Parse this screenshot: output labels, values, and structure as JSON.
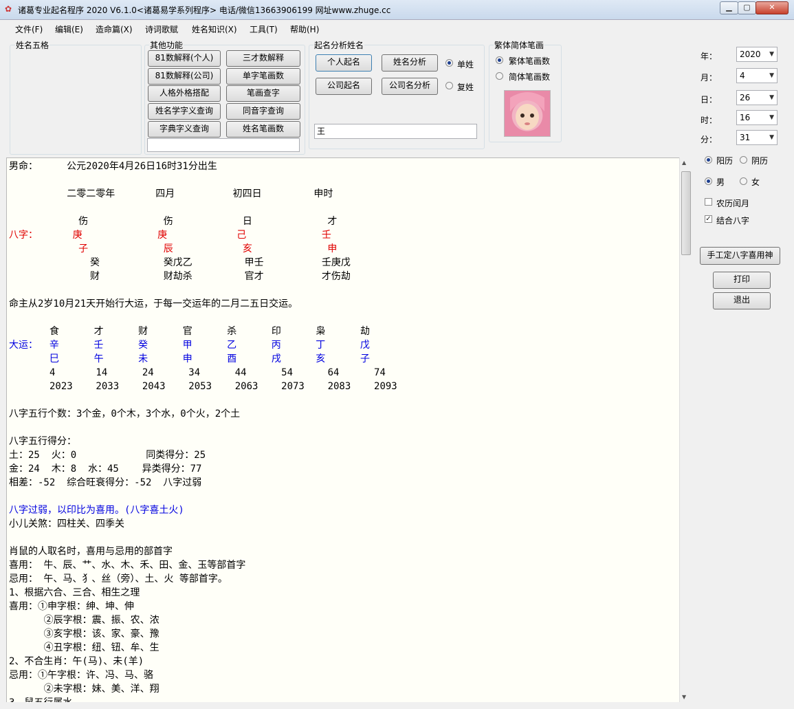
{
  "window": {
    "title": "诸葛专业起名程序  2020 V6.1.0<诸葛易学系列程序>  电话/微信13663906199  网址www.zhuge.cc",
    "icon": "app-flower-icon",
    "minimize_icon": "minimize-icon",
    "maximize_icon": "maximize-icon",
    "close_icon": "close-icon"
  },
  "menu": [
    "文件(F)",
    "编辑(E)",
    "造命篇(X)",
    "诗词歌赋",
    "姓名知识(X)",
    "工具(T)",
    "帮助(H)"
  ],
  "groups": {
    "wuge": "姓名五格",
    "other": "其他功能",
    "analysis": "起名分析姓名",
    "stroke": "繁体简体笔画"
  },
  "other_buttons": [
    "81数解释(个人)",
    "三才数解释",
    "81数解释(公司)",
    "单字笔画数",
    "人格外格搭配",
    "笔画查字",
    "姓名学字义查询",
    "同音字查询",
    "字典字义查询",
    "姓名笔画数"
  ],
  "analysis": {
    "personal_name": "个人起名",
    "name_analysis": "姓名分析",
    "company_name": "公司起名",
    "company_analysis": "公司名分析",
    "single_surname": "单姓",
    "double_surname": "复姓",
    "surname_value": "王"
  },
  "stroke": {
    "traditional": "繁体笔画数",
    "simplified": "简体笔画数",
    "photo": "baby-photo"
  },
  "datetime": {
    "year_label": "年：",
    "year": "2020",
    "month_label": "月：",
    "month": "4",
    "day_label": "日：",
    "day": "26",
    "hour_label": "时：",
    "hour": "16",
    "minute_label": "分：",
    "minute": "31"
  },
  "options": {
    "solar": "阳历",
    "lunar": "阴历",
    "male": "男",
    "female": "女",
    "leap_month": "农历闰月",
    "combine_bazi": "结合八字",
    "manual_button": "手工定八字喜用神",
    "print_button": "打印",
    "exit_button": "退出"
  },
  "colors": {
    "red_text": "#e00000",
    "blue_text": "#0000e0"
  },
  "content": {
    "lines": [
      {
        "t": "男命：     公元2020年4月26日16时31分出生",
        "c": ""
      },
      {
        "t": "",
        "c": ""
      },
      {
        "t": "          二零二零年       四月          初四日         申时",
        "c": ""
      },
      {
        "t": "",
        "c": ""
      },
      {
        "t": "            伤             伤            日             才",
        "c": ""
      },
      {
        "t": "八字：      庚             庚            己             壬",
        "c": "red"
      },
      {
        "t": "            子             辰            亥             申",
        "c": "red"
      },
      {
        "t": "              癸           癸戊乙         甲壬          壬庚戊",
        "c": ""
      },
      {
        "t": "              财           财劫杀         官才          才伤劫",
        "c": ""
      },
      {
        "t": "",
        "c": ""
      },
      {
        "t": "命主从2岁10月21天开始行大运，于每一交运年的二月二五日交运。",
        "c": ""
      },
      {
        "t": "",
        "c": ""
      },
      {
        "t": "       食      才      财      官      杀      印      枭      劫",
        "c": ""
      },
      {
        "t": "大运：  辛      壬      癸      甲      乙      丙      丁      戊",
        "c": "blue"
      },
      {
        "t": "       巳      午      未      申      酉      戌      亥      子",
        "c": "blue"
      },
      {
        "t": "       4       14      24      34      44      54      64      74",
        "c": ""
      },
      {
        "t": "       2023    2033    2043    2053    2063    2073    2083    2093",
        "c": ""
      },
      {
        "t": "",
        "c": ""
      },
      {
        "t": "八字五行个数：3个金，0个木，3个水，0个火，2个土",
        "c": ""
      },
      {
        "t": "",
        "c": ""
      },
      {
        "t": "八字五行得分：",
        "c": ""
      },
      {
        "t": "土：25  火：0            同类得分：25",
        "c": ""
      },
      {
        "t": "金：24  木：8  水：45    异类得分：77",
        "c": ""
      },
      {
        "t": "相差：-52  综合旺衰得分：-52  八字过弱",
        "c": ""
      },
      {
        "t": "",
        "c": ""
      },
      {
        "t": "八字过弱，以印比为喜用。(八字喜土火)",
        "c": "blue"
      },
      {
        "t": "小儿关煞：四柱关、四季关",
        "c": ""
      },
      {
        "t": "",
        "c": ""
      },
      {
        "t": "肖鼠的人取名时，喜用与忌用的部首字",
        "c": ""
      },
      {
        "t": "喜用： 牛、辰、艹、水、木、禾、田、金、玉等部首字",
        "c": ""
      },
      {
        "t": "忌用： 午、马、犭、丝（旁）、土、火 等部首字。",
        "c": ""
      },
      {
        "t": "1、根据六合、三合、相生之理",
        "c": ""
      },
      {
        "t": "喜用：①申字根：绅、坤、伸",
        "c": ""
      },
      {
        "t": "      ②辰字根：震、振、农、浓",
        "c": ""
      },
      {
        "t": "      ③亥字根：该、家、豪、豫",
        "c": ""
      },
      {
        "t": "      ④丑字根：纽、钮、牟、生",
        "c": ""
      },
      {
        "t": "2、不合生肖：午(马)、未(羊)",
        "c": ""
      },
      {
        "t": "忌用：①午字根：许、冯、马、骆",
        "c": ""
      },
      {
        "t": "      ②未字根：妹、美、洋、翔",
        "c": ""
      },
      {
        "t": "3、鼠五行属水",
        "c": ""
      }
    ]
  }
}
